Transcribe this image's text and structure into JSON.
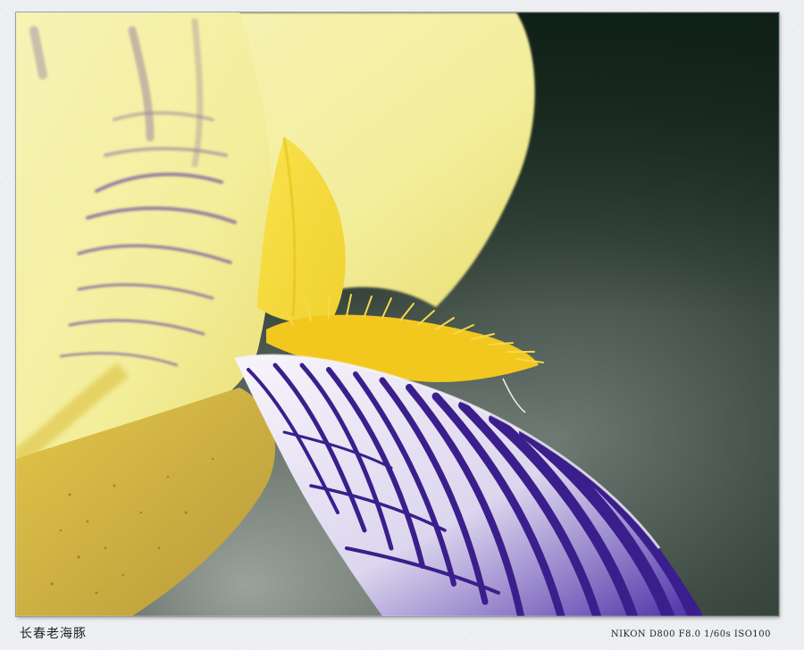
{
  "photo": {
    "subject": "iris-flower-macro",
    "colors": {
      "background_dark": "#1a2a1e",
      "background_mid": "#56625b",
      "petal_yellow": "#f4ef9c",
      "beard_yellow": "#f2c81e",
      "falls_purple": "#3a1f8c",
      "falls_white": "#f4f2f8"
    }
  },
  "caption": {
    "author": "长春老海豚",
    "exif": "NIKON D800 F8.0 1/60s ISO100"
  }
}
